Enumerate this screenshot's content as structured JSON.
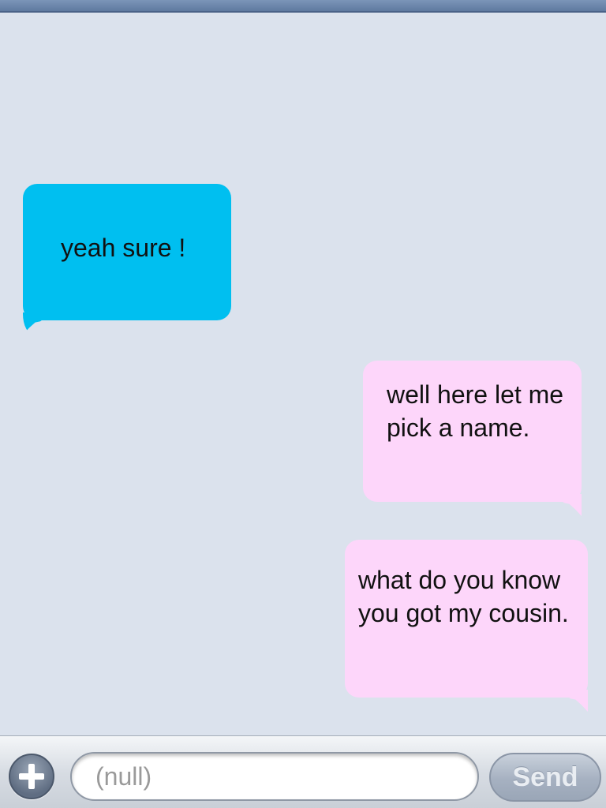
{
  "messages": [
    {
      "direction": "incoming",
      "text": "yeah sure !"
    },
    {
      "direction": "outgoing",
      "text": "well here let me pick a name."
    },
    {
      "direction": "outgoing",
      "text": "what do you know you got my cousin."
    }
  ],
  "composer": {
    "input_value": "",
    "input_placeholder": "(null)",
    "send_label": "Send"
  },
  "colors": {
    "incoming_bubble": "#00bff0",
    "outgoing_bubble": "#fdd6fa",
    "background": "#dbe2ed"
  }
}
